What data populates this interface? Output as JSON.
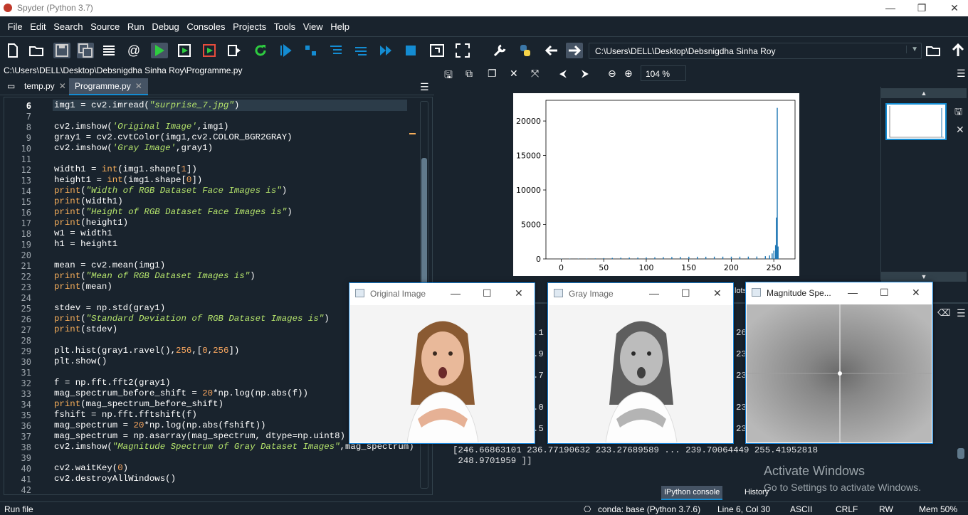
{
  "window": {
    "title": "Spyder (Python 3.7)",
    "min": "—",
    "restore": "❐",
    "close": "✕"
  },
  "menu": [
    "File",
    "Edit",
    "Search",
    "Source",
    "Run",
    "Debug",
    "Consoles",
    "Projects",
    "Tools",
    "View",
    "Help"
  ],
  "toolbar": {
    "path": "C:\\Users\\DELL\\Desktop\\Debsnigdha Sinha Roy"
  },
  "editor": {
    "filepath": "C:\\Users\\DELL\\Desktop\\Debsnigdha Sinha Roy\\Programme.py",
    "tabs": [
      {
        "label": "temp.py"
      },
      {
        "label": "Programme.py"
      }
    ],
    "lines": [
      "6",
      "7",
      "8",
      "9",
      "10",
      "11",
      "12",
      "13",
      "14",
      "15",
      "16",
      "17",
      "18",
      "19",
      "20",
      "21",
      "22",
      "23",
      "24",
      "25",
      "26",
      "27",
      "28",
      "29",
      "30",
      "31",
      "32",
      "33",
      "34",
      "35",
      "36",
      "37",
      "38",
      "39",
      "40",
      "41",
      "42"
    ]
  },
  "plots": {
    "zoom": "104 %",
    "yticks": [
      "20000",
      "15000",
      "10000",
      "5000",
      "0"
    ],
    "xticks": [
      "0",
      "50",
      "100",
      "150",
      "200",
      "250"
    ]
  },
  "console": {
    "line1": "[246.66863101 236.77190632 233.27689589 ... 239.70064449 255.41952818",
    "line2": " 248.9701959 ]]",
    "frag": [
      ".1",
      ".9",
      ".7",
      ".0",
      ".5"
    ],
    "rfrag": [
      "26",
      "23",
      "23",
      "23",
      "23"
    ],
    "tabs": {
      "ipython": "IPython console",
      "history": "History"
    },
    "hidden_tab": "lots"
  },
  "watermark": {
    "line1": "Activate Windows",
    "line2": "Go to Settings to activate Windows."
  },
  "status": {
    "left": "Run file",
    "env": "conda: base (Python 3.7.6)",
    "pos": "Line 6, Col 30",
    "enc": "ASCII",
    "eol": "CRLF",
    "rw": "RW",
    "mem": "Mem 50%"
  },
  "cvwindows": {
    "original": "Original Image",
    "gray": "Gray Image",
    "magnitude": "Magnitude Spe..."
  },
  "chart_data": {
    "type": "bar",
    "title": "",
    "xlabel": "",
    "ylabel": "",
    "xlim": [
      -18,
      275
    ],
    "ylim": [
      0,
      23000
    ],
    "x": [
      0,
      10,
      20,
      30,
      40,
      50,
      60,
      70,
      80,
      90,
      100,
      110,
      120,
      130,
      140,
      150,
      160,
      170,
      180,
      190,
      200,
      210,
      220,
      230,
      240,
      245,
      248,
      250,
      252,
      253,
      254,
      255
    ],
    "values": [
      40,
      40,
      40,
      60,
      80,
      120,
      150,
      180,
      200,
      200,
      220,
      240,
      260,
      280,
      300,
      320,
      320,
      320,
      330,
      330,
      330,
      330,
      340,
      350,
      400,
      500,
      800,
      1200,
      2000,
      6000,
      21900,
      1800
    ]
  }
}
